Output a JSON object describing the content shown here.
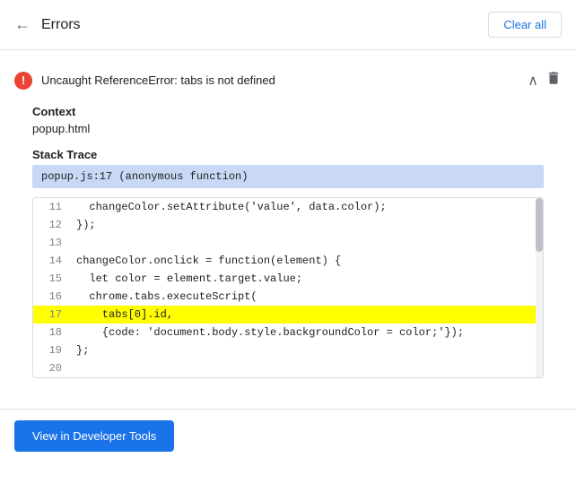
{
  "header": {
    "back_icon": "←",
    "title": "Errors",
    "clear_all_label": "Clear all"
  },
  "error": {
    "icon_symbol": "!",
    "message": "Uncaught ReferenceError: tabs is not defined",
    "chevron_symbol": "∧",
    "delete_symbol": "🗑"
  },
  "context": {
    "label": "Context",
    "value": "popup.html"
  },
  "stack_trace": {
    "label": "Stack Trace",
    "highlighted_line": "popup.js:17 (anonymous function)"
  },
  "code_lines": [
    {
      "num": "11",
      "code": "  changeColor.setAttribute('value', data.color);",
      "highlight": false
    },
    {
      "num": "12",
      "code": "});",
      "highlight": false
    },
    {
      "num": "13",
      "code": "",
      "highlight": false
    },
    {
      "num": "14",
      "code": "changeColor.onclick = function(element) {",
      "highlight": false
    },
    {
      "num": "15",
      "code": "  let color = element.target.value;",
      "highlight": false
    },
    {
      "num": "16",
      "code": "  chrome.tabs.executeScript(",
      "highlight": false
    },
    {
      "num": "17",
      "code": "    tabs[0].id,",
      "highlight": true
    },
    {
      "num": "18",
      "code": "    {code: 'document.body.style.backgroundColor = color;'});",
      "highlight": false
    },
    {
      "num": "19",
      "code": "};",
      "highlight": false
    },
    {
      "num": "20",
      "code": "",
      "highlight": false
    }
  ],
  "footer": {
    "dev_tools_label": "View in Developer Tools"
  }
}
